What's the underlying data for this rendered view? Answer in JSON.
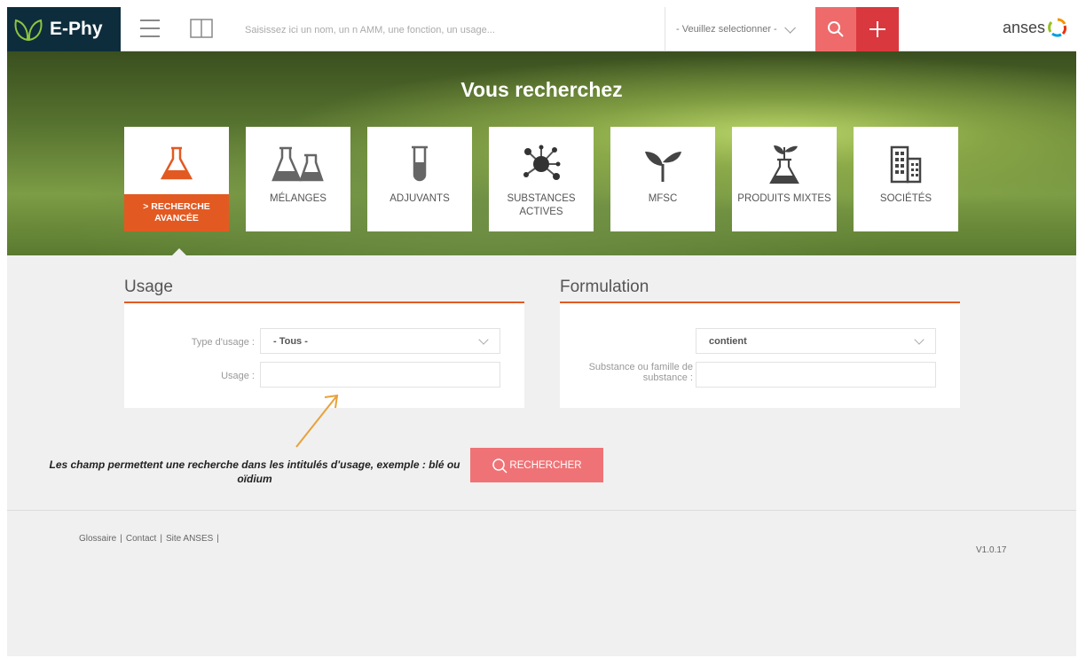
{
  "header": {
    "logo_text": "E-Phy",
    "search_placeholder": "Saisissez ici un nom, un n AMM, une fonction, un usage...",
    "select_label": "- Veuillez selectionner -",
    "brand": "anses",
    "accent": "#ef6b6b",
    "accent_dark": "#d9383e",
    "logo_bg": "#0e2d3c"
  },
  "hero": {
    "title": "Vous recherchez",
    "tiles": [
      {
        "label": "> RECHERCHE AVANCÉE",
        "icon": "flask-icon",
        "active": true
      },
      {
        "label": "MÉLANGES",
        "icon": "flasks-icon"
      },
      {
        "label": "ADJUVANTS",
        "icon": "test-tube-icon"
      },
      {
        "label": "SUBSTANCES ACTIVES",
        "icon": "molecule-icon"
      },
      {
        "label": "MFSC",
        "icon": "sprout-icon"
      },
      {
        "label": "PRODUITS MIXTES",
        "icon": "plant-flask-icon"
      },
      {
        "label": "SOCIÉTÉS",
        "icon": "buildings-icon"
      }
    ],
    "active_color": "#e25a22"
  },
  "usage": {
    "title": "Usage",
    "type_label": "Type d'usage :",
    "type_value": "- Tous -",
    "usage_label": "Usage :",
    "usage_value": ""
  },
  "formulation": {
    "title": "Formulation",
    "operator_value": "contient",
    "substance_label": "Substance ou famille de substance :",
    "substance_value": ""
  },
  "note": "Les champ permettent une recherche dans les intitulés d'usage, exemple : blé ou oïdium",
  "search_button": "RECHERCHER",
  "footer": {
    "links": [
      "Glossaire",
      "Contact",
      "Site ANSES"
    ],
    "version": "V1.0.17"
  }
}
